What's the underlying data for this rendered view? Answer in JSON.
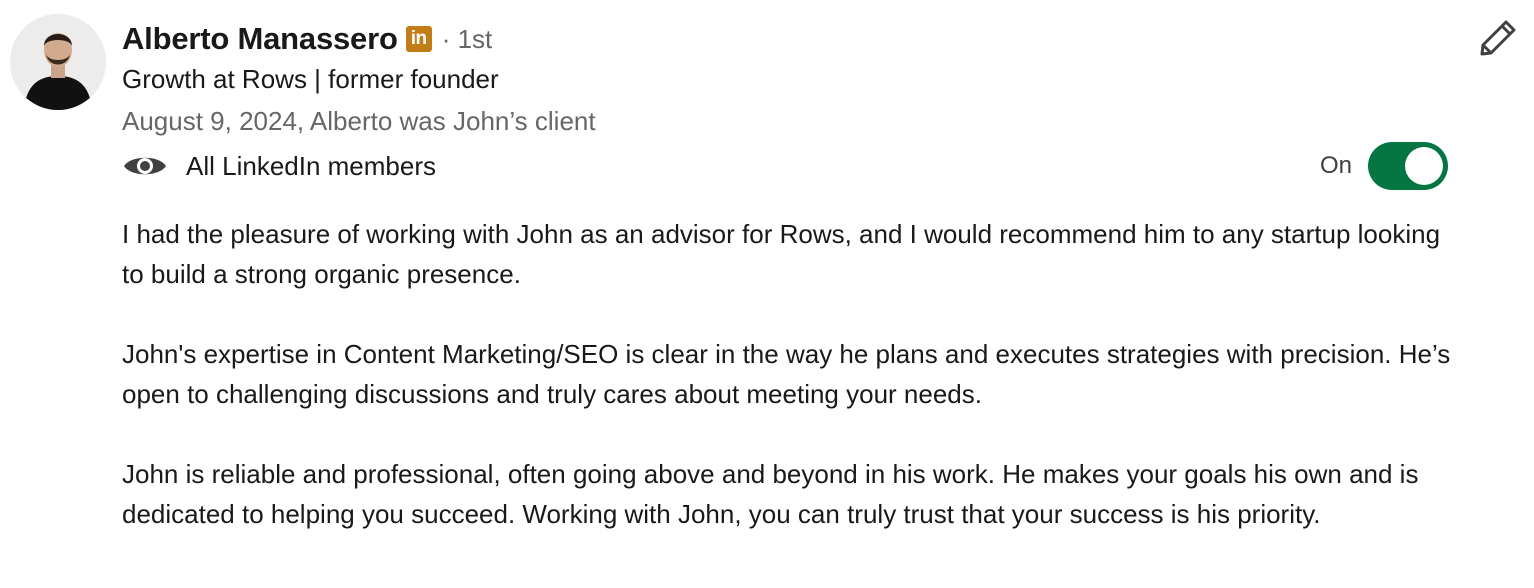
{
  "recommendation": {
    "author": {
      "name": "Alberto Manassero",
      "badge_text": "in",
      "degree": "· 1st",
      "headline": "Growth at Rows | former founder"
    },
    "meta": "August 9, 2024, Alberto was John’s client",
    "visibility": {
      "icon": "eye-icon",
      "label": "All LinkedIn members",
      "toggle_label": "On",
      "toggle_on": true
    },
    "paragraphs": [
      "I had the pleasure of working with John as an advisor for Rows, and I would recommend him to any startup looking to build a strong organic presence.",
      "John's expertise in Content Marketing/SEO is clear in the way he plans and executes strategies with precision. He’s open to challenging discussions and truly cares about meeting your needs.",
      "John is reliable and professional, often going above and beyond in his work. He makes your goals his own and is dedicated to helping you succeed. Working with John, you can truly trust that your success is his priority."
    ],
    "edit_icon": "pencil-icon"
  },
  "colors": {
    "text_primary": "#191919",
    "text_secondary": "#666666",
    "toggle_on": "#057642",
    "linkedin_badge": "#c37d16"
  }
}
